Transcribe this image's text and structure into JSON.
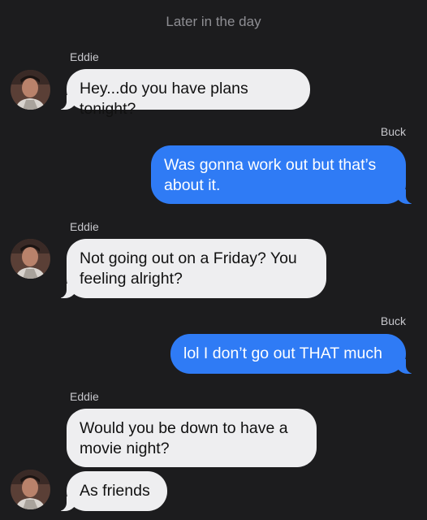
{
  "conversation": {
    "time_label": "Later in the day",
    "messages": [
      {
        "sender": "Eddie",
        "text": "Hey...do you have plans tonight?"
      },
      {
        "sender": "Buck",
        "text": "Was gonna work out but that’s about it."
      },
      {
        "sender": "Eddie",
        "text": "Not going out on a Friday? You feeling alright?"
      },
      {
        "sender": "Buck",
        "text": "lol I don’t go out THAT much"
      },
      {
        "sender": "Eddie",
        "text": "Would you be down to have a movie night?"
      },
      {
        "sender": "Eddie",
        "text": "As friends"
      }
    ]
  },
  "colors": {
    "background": "#1c1c1e",
    "incoming_bubble": "#eeeef0",
    "outgoing_bubble": "#2f7bf5"
  },
  "icons": {
    "avatar": "contact-avatar-photo"
  }
}
